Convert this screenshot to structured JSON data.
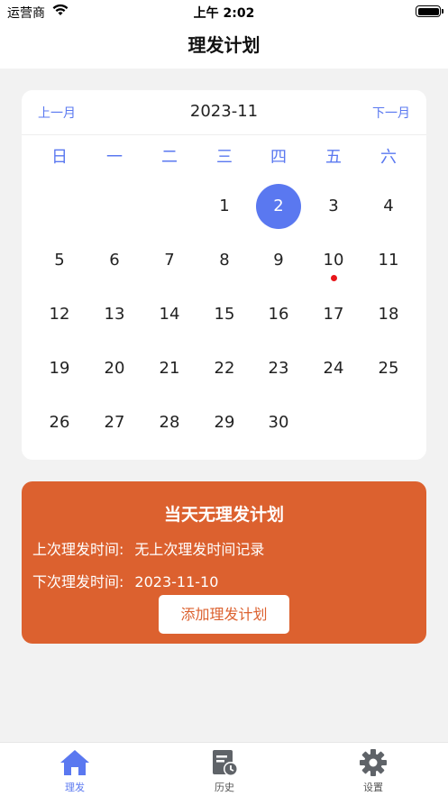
{
  "status_bar": {
    "carrier": "运营商",
    "time": "上午 2:02"
  },
  "nav": {
    "title": "理发计划"
  },
  "calendar": {
    "prev_label": "上一月",
    "next_label": "下一月",
    "month": "2023-11",
    "weekdays": [
      "日",
      "一",
      "二",
      "三",
      "四",
      "五",
      "六"
    ],
    "first_weekday_index": 3,
    "days_in_month": 30,
    "selected_day": 2,
    "marked_days": [
      10
    ]
  },
  "plan": {
    "headline": "当天无理发计划",
    "last_label": "上次理发时间:",
    "last_value": "无上次理发时间记录",
    "next_label": "下次理发时间:",
    "next_value": "2023-11-10",
    "add_button": "添加理发计划"
  },
  "tabs": [
    {
      "label": "理发",
      "icon": "home-icon",
      "active": true
    },
    {
      "label": "历史",
      "icon": "history-icon",
      "active": false
    },
    {
      "label": "设置",
      "icon": "gear-icon",
      "active": false
    }
  ],
  "colors": {
    "accent": "#5a78f0",
    "card": "#dc612f",
    "dot": "#e8161a"
  }
}
